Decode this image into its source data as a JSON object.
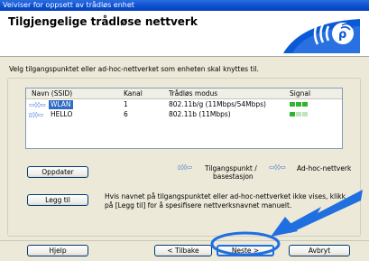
{
  "window": {
    "title": "Veiviser for oppsett av trådløs enhet"
  },
  "header": {
    "title": "Tilgjengelige trådløse nettverk",
    "logo_text": "((( (ᵍ)"
  },
  "description": "Velg tilgangspunktet eller ad-hoc-nettverket som enheten skal knyttes til.",
  "list": {
    "columns": [
      "Navn (SSID)",
      "Kanal",
      "Trådløs modus",
      "Signal"
    ],
    "rows": [
      {
        "icon": "ad-hoc",
        "name": "WLAN",
        "channel": "1",
        "mode": "802.11b/g (11Mbps/54Mbps)",
        "signal": 3,
        "selected": true
      },
      {
        "icon": "access-point",
        "name": "HELLO",
        "channel": "6",
        "mode": "802.11b (11Mbps)",
        "signal": 1,
        "selected": false
      }
    ]
  },
  "buttons": {
    "refresh": "Oppdater",
    "add": "Legg til",
    "help": "Hjelp",
    "back": "< Tilbake",
    "next": "Neste >",
    "cancel": "Avbryt"
  },
  "legend": {
    "access_point": "Tilgangspunkt /",
    "base_station": "basestasjon",
    "adhoc": "Ad-hoc-nettverk"
  },
  "help_text": "Hvis navnet på tilgangspunktet eller ad-hoc-nettverket ikke vises, klikk på [Legg til] for å spesifisere nettverksnavnet manuelt.",
  "colors": {
    "titlebar": "#0a4fd2",
    "selection": "#316ac5",
    "signal_on": "#2fb52f",
    "signal_off": "#bfe4bf",
    "callout": "#1f6fe0"
  }
}
